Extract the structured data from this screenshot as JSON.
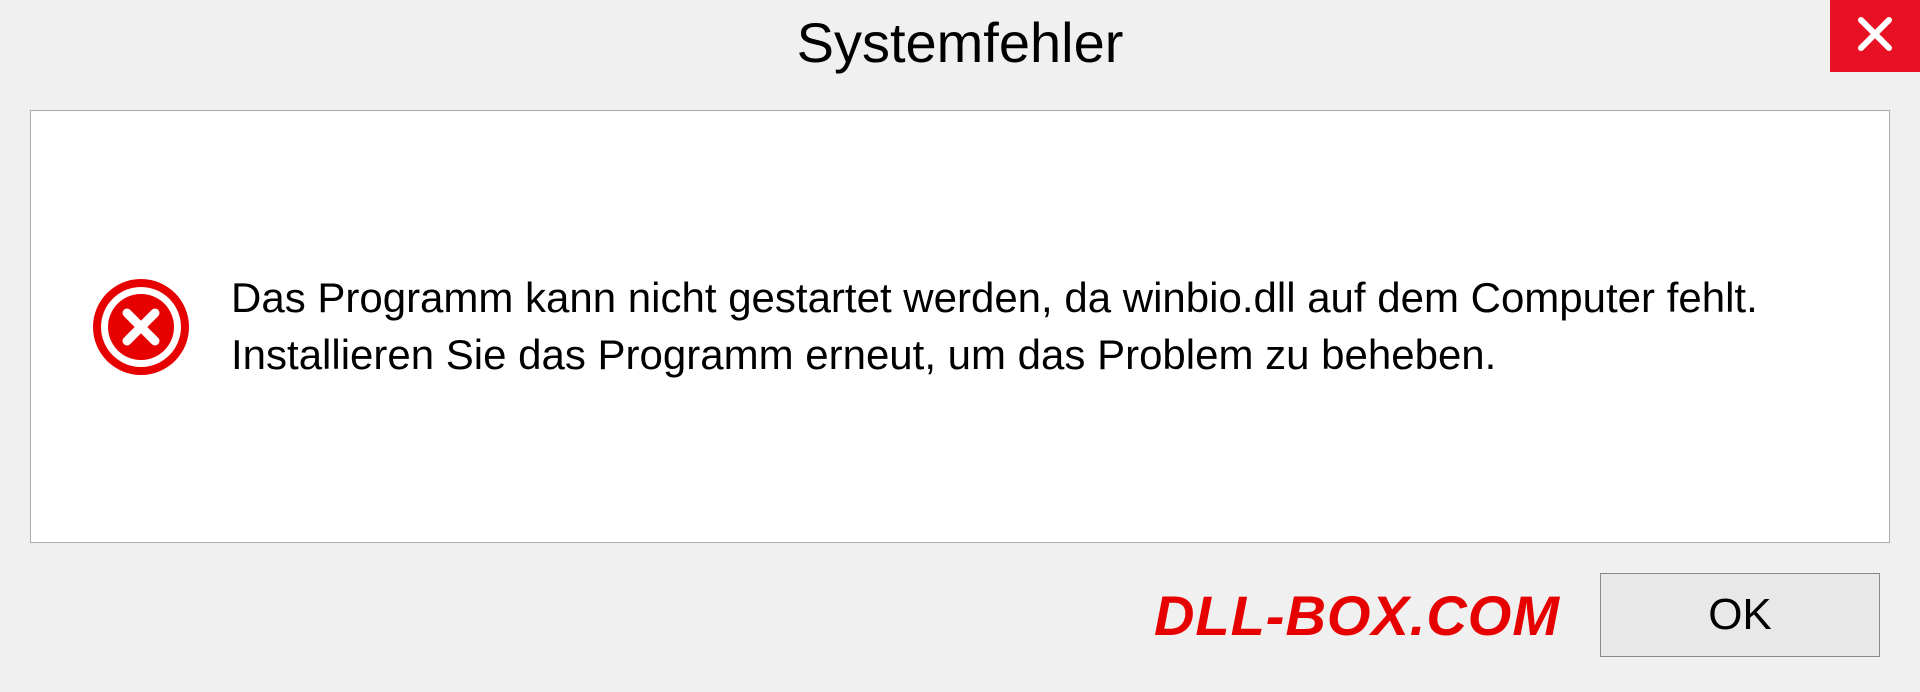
{
  "dialog": {
    "title": "Systemfehler",
    "message": "Das Programm kann nicht gestartet werden, da winbio.dll auf dem Computer fehlt. Installieren Sie das Programm erneut, um das Problem zu beheben.",
    "ok_label": "OK"
  },
  "watermark": "DLL-BOX.COM",
  "colors": {
    "close_bg": "#e81123",
    "error_icon": "#e60000",
    "watermark": "#e60000"
  }
}
